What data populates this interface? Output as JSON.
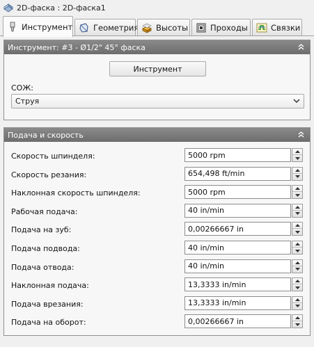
{
  "window": {
    "title": "2D-фаска : 2D-фаска1"
  },
  "tabs": [
    {
      "label": "Инструмент",
      "icon": "tool-icon",
      "active": true
    },
    {
      "label": "Геометрия",
      "icon": "geometry-icon",
      "active": false
    },
    {
      "label": "Высоты",
      "icon": "heights-icon",
      "active": false
    },
    {
      "label": "Проходы",
      "icon": "passes-icon",
      "active": false
    },
    {
      "label": "Связки",
      "icon": "linking-icon",
      "active": false
    }
  ],
  "tool_panel": {
    "title": "Инструмент: #3 - Ø1/2\" 45° фаска",
    "tool_button": "Инструмент",
    "coolant_label": "СОЖ:",
    "coolant_value": "Струя"
  },
  "feed_panel": {
    "title": "Подача и скорость",
    "rows": [
      {
        "label": "Скорость шпинделя:",
        "value": "5000 rpm"
      },
      {
        "label": "Скорость резания:",
        "value": "654,498 ft/min"
      },
      {
        "label": "Наклонная скорость шпинделя:",
        "value": "5000 rpm"
      },
      {
        "label": "Рабочая подача:",
        "value": "40 in/min"
      },
      {
        "label": "Подача на зуб:",
        "value": "0,00266667 in"
      },
      {
        "label": "Подача подвода:",
        "value": "40 in/min"
      },
      {
        "label": "Подача отвода:",
        "value": "40 in/min"
      },
      {
        "label": "Наклонная подача:",
        "value": "13,3333 in/min"
      },
      {
        "label": "Подача врезания:",
        "value": "13,3333 in/min"
      },
      {
        "label": "Подача на оборот:",
        "value": "0,00266667 in"
      }
    ]
  },
  "colors": {
    "panel_header": "#7a7a7a",
    "background": "#f0f0f0"
  }
}
